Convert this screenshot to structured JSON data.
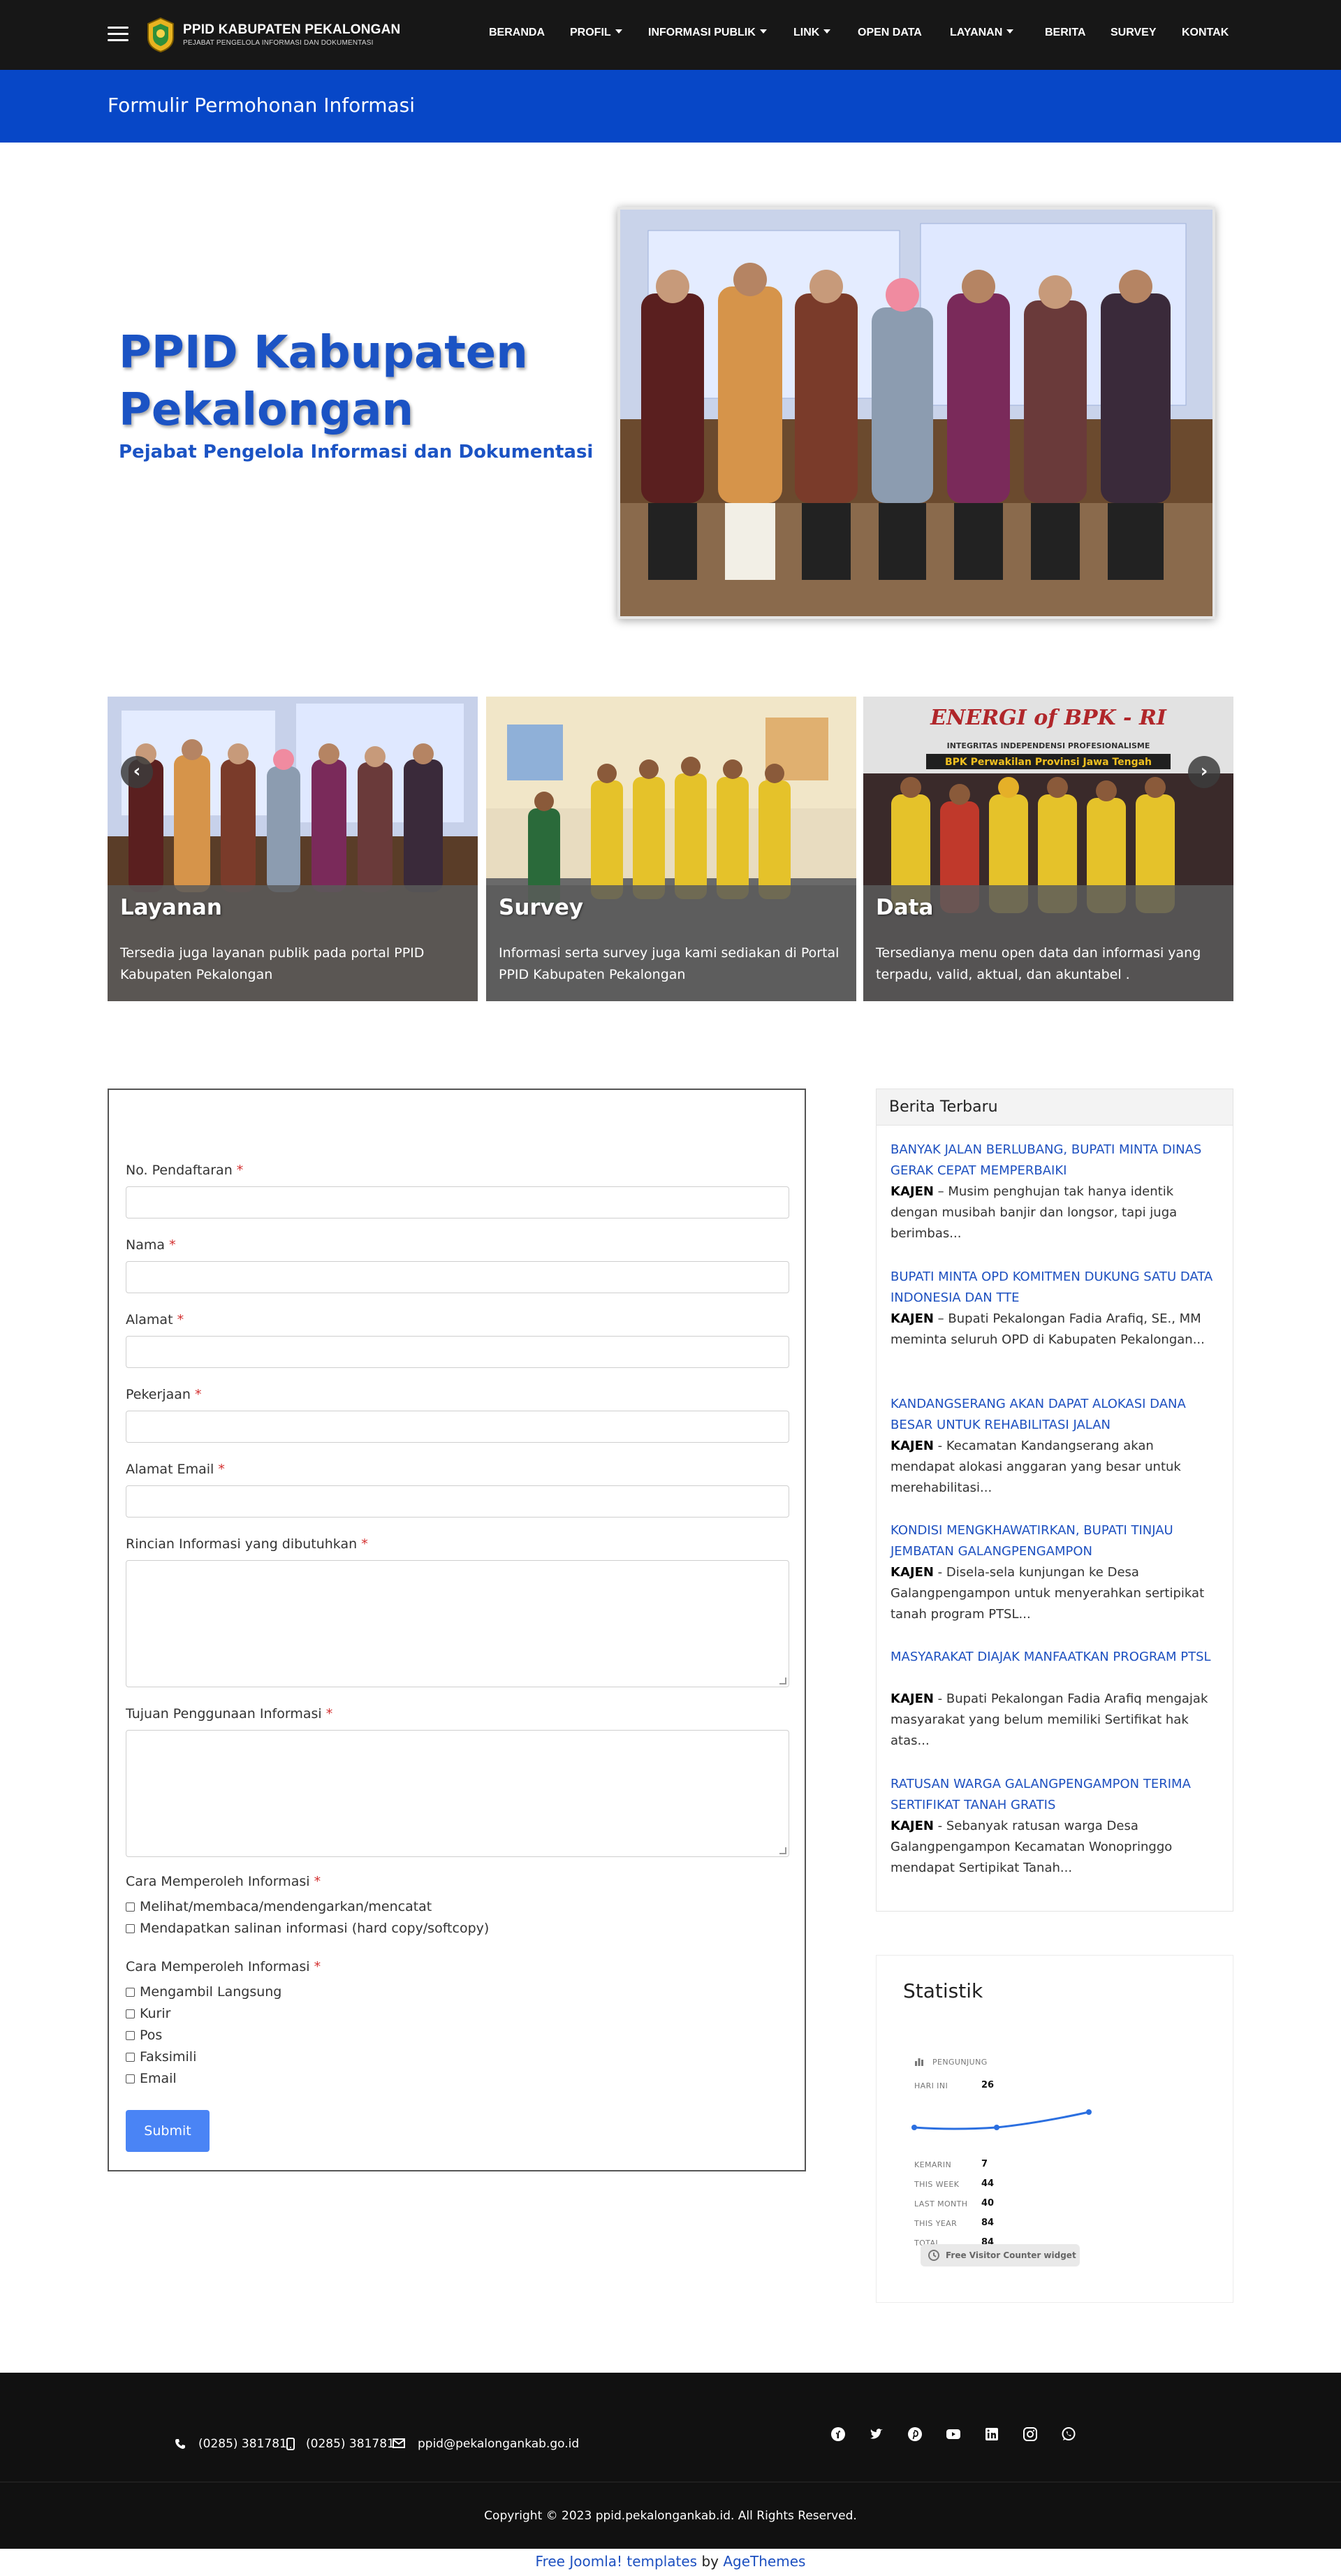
{
  "brand": {
    "title": "PPID KABUPATEN PEKALONGAN",
    "subtitle": "PEJABAT PENGELOLA INFORMASI DAN DOKUMENTASI"
  },
  "nav": {
    "items": [
      {
        "label": "BERANDA"
      },
      {
        "label": "PROFIL"
      },
      {
        "label": "INFORMASI PUBLIK"
      },
      {
        "label": "LINK"
      },
      {
        "label": "OPEN DATA"
      },
      {
        "label": "LAYANAN"
      },
      {
        "label": "BERITA"
      },
      {
        "label": "SURVEY"
      },
      {
        "label": "KONTAK"
      }
    ]
  },
  "banner": {
    "title": "Formulir Permohonan Informasi"
  },
  "hero": {
    "title": "PPID Kabupaten Pekalongan",
    "subtitle": "Pejabat Pengelola Informasi dan Dokumentasi"
  },
  "carousel": {
    "slides": [
      {
        "title": "Layanan",
        "text": "Tersedia juga layanan publik pada portal PPID Kabupaten Pekalongan"
      },
      {
        "title": "Survey",
        "text": "Informasi serta survey juga kami sediakan di Portal PPID Kabupaten Pekalongan"
      },
      {
        "title": "Data",
        "text": "Tersedianya menu open data dan informasi yang terpadu, valid, aktual, dan akuntabel ."
      }
    ],
    "prev": "‹",
    "next": "›",
    "slide3_photo_text": {
      "line1": "ENERGI of BPK - RI",
      "line2": "INTEGRITAS INDEPENDENSI PROFESIONALISME",
      "line3": "BPK Perwakilan Provinsi Jawa Tengah"
    }
  },
  "form": {
    "required_mark": "*",
    "fields": [
      {
        "label": "No. Pendaftaran"
      },
      {
        "label": "Nama"
      },
      {
        "label": "Alamat"
      },
      {
        "label": "Pekerjaan"
      },
      {
        "label": "Alamat Email"
      },
      {
        "label": "Rincian Informasi yang dibutuhkan"
      },
      {
        "label": "Tujuan Penggunaan Informasi"
      }
    ],
    "group1": {
      "label": "Cara Memperoleh Informasi",
      "options": [
        "Melihat/membaca/mendengarkan/mencatat",
        "Mendapatkan salinan informasi (hard copy/softcopy)"
      ]
    },
    "group2": {
      "label": "Cara Memperoleh Informasi",
      "options": [
        "Mengambil Langsung",
        "Kurir",
        "Pos",
        "Faksimili",
        "Email"
      ]
    },
    "submit_label": "Submit"
  },
  "news": {
    "heading": "Berita Terbaru",
    "items": [
      {
        "title": "BANYAK JALAN BERLUBANG, BUPATI MINTA DINAS GERAK CEPAT MEMPERBAIKI",
        "lead": "KAJEN",
        "text": " – Musim penghujan tak hanya identik dengan musibah banjir dan longsor, tapi juga berimbas..."
      },
      {
        "title": "BUPATI MINTA OPD KOMITMEN DUKUNG SATU DATA INDONESIA DAN TTE",
        "lead": "KAJEN",
        "text": " – Bupati Pekalongan Fadia Arafiq, SE., MM meminta seluruh OPD di Kabupaten Pekalongan..."
      },
      {
        "title": "KANDANGSERANG AKAN DAPAT ALOKASI DANA BESAR UNTUK REHABILITASI JALAN",
        "lead": "KAJEN",
        "text": " - Kecamatan Kandangserang akan mendapat alokasi anggaran yang besar untuk merehabilitasi..."
      },
      {
        "title": "KONDISI MENGKHAWATIRKAN, BUPATI TINJAU JEMBATAN GALANGPENGAMPON",
        "lead": "KAJEN",
        "text": " - Disela-sela kunjungan ke Desa Galangpengampon untuk menyerahkan sertipikat tanah program PTSL..."
      },
      {
        "title": "MASYARAKAT DIAJAK MANFAATKAN PROGRAM PTSL",
        "lead": "KAJEN",
        "text": " - Bupati Pekalongan Fadia Arafiq mengajak masyarakat yang belum memiliki Sertifikat hak atas..."
      },
      {
        "title": "RATUSAN WARGA GALANGPENGAMPON TERIMA SERTIFIKAT TANAH GRATIS",
        "lead": "KAJEN",
        "text": " - Sebanyak ratusan warga Desa Galangpengampon Kecamatan Wonopringgo mendapat Sertipikat Tanah..."
      }
    ]
  },
  "stats": {
    "title": "Statistik",
    "visitors_label": "PENGUNJUNG",
    "rows": [
      {
        "label": "HARI INI",
        "value": "26"
      },
      {
        "label": "KEMARIN",
        "value": "7"
      },
      {
        "label": "THIS WEEK",
        "value": "44"
      },
      {
        "label": "LAST MONTH",
        "value": "40"
      },
      {
        "label": "THIS YEAR",
        "value": "84"
      },
      {
        "label": "TOTAL",
        "value": "84"
      }
    ],
    "widget_label": "Free Visitor Counter widget"
  },
  "footer": {
    "phone1": "(0285) 381781",
    "phone2": "(0285) 381781",
    "email": "ppid@pekalongankab.go.id",
    "copyright": "Copyright © 2023 ppid.pekalongankab.id. All Rights Reserved.",
    "credit_link": "Free Joomla! templates",
    "credit_by": "by",
    "credit_author": "AgeThemes"
  },
  "colors": {
    "navbar": "#171717",
    "banner": "#0747c7",
    "hero_text": "#1b53c4",
    "link": "#1d50c0",
    "submit": "#4a84f5",
    "required": "#d32f2f"
  }
}
